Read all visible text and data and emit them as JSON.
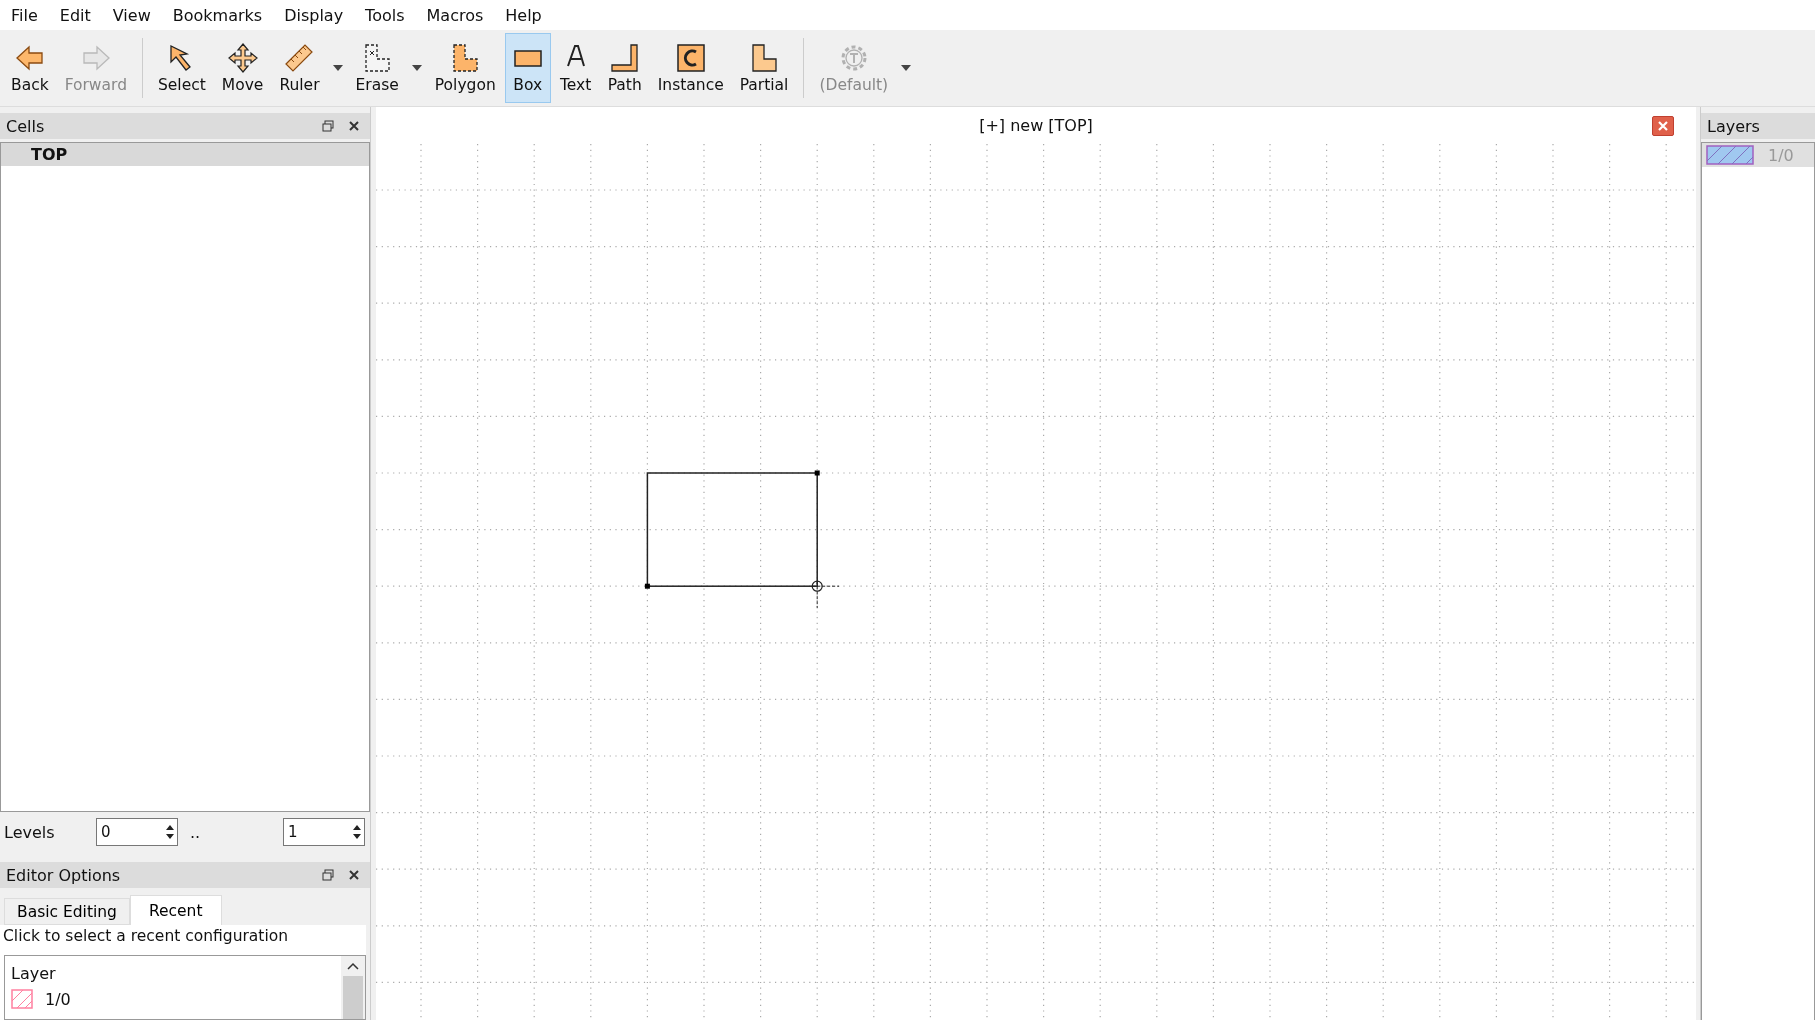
{
  "menu": [
    "File",
    "Edit",
    "View",
    "Bookmarks",
    "Display",
    "Tools",
    "Macros",
    "Help"
  ],
  "toolbar": [
    {
      "kind": "button",
      "label": "Back",
      "disabled": false,
      "selected": false
    },
    {
      "kind": "button",
      "label": "Forward",
      "disabled": true,
      "selected": false
    },
    {
      "kind": "separator"
    },
    {
      "kind": "button",
      "label": "Select",
      "disabled": false,
      "selected": false
    },
    {
      "kind": "button",
      "label": "Move",
      "disabled": false,
      "selected": false
    },
    {
      "kind": "button",
      "label": "Ruler",
      "disabled": false,
      "selected": false
    },
    {
      "kind": "dropdown"
    },
    {
      "kind": "button",
      "label": "Erase",
      "disabled": false,
      "selected": false
    },
    {
      "kind": "dropdown"
    },
    {
      "kind": "button",
      "label": "Polygon",
      "disabled": false,
      "selected": false
    },
    {
      "kind": "button",
      "label": "Box",
      "disabled": false,
      "selected": true
    },
    {
      "kind": "button",
      "label": "Text",
      "disabled": false,
      "selected": false
    },
    {
      "kind": "button",
      "label": "Path",
      "disabled": false,
      "selected": false
    },
    {
      "kind": "button",
      "label": "Instance",
      "disabled": false,
      "selected": false
    },
    {
      "kind": "button",
      "label": "Partial",
      "disabled": false,
      "selected": false
    },
    {
      "kind": "separator"
    },
    {
      "kind": "button",
      "label": "(Default)",
      "disabled": true,
      "selected": false
    },
    {
      "kind": "dropdown"
    }
  ],
  "cells": {
    "title": "Cells",
    "tree": [
      {
        "label": "TOP",
        "selected": true
      }
    ]
  },
  "levels": {
    "label": "Levels",
    "from": "0",
    "separator": "..",
    "to": "1"
  },
  "editor_options": {
    "title": "Editor Options",
    "tabs": [
      {
        "label": "Basic Editing",
        "selected": false
      },
      {
        "label": "Recent",
        "selected": true
      }
    ],
    "hint": "Click to select a recent configuration",
    "list_header": "Layer",
    "rows": [
      {
        "label": "1/0",
        "color": "#ff80a0"
      }
    ]
  },
  "canvas": {
    "title": "[+] new [TOP]"
  },
  "layers": {
    "title": "Layers",
    "items": [
      {
        "label": "1/0",
        "color": "#a0c8f0",
        "selected": true
      }
    ]
  }
}
